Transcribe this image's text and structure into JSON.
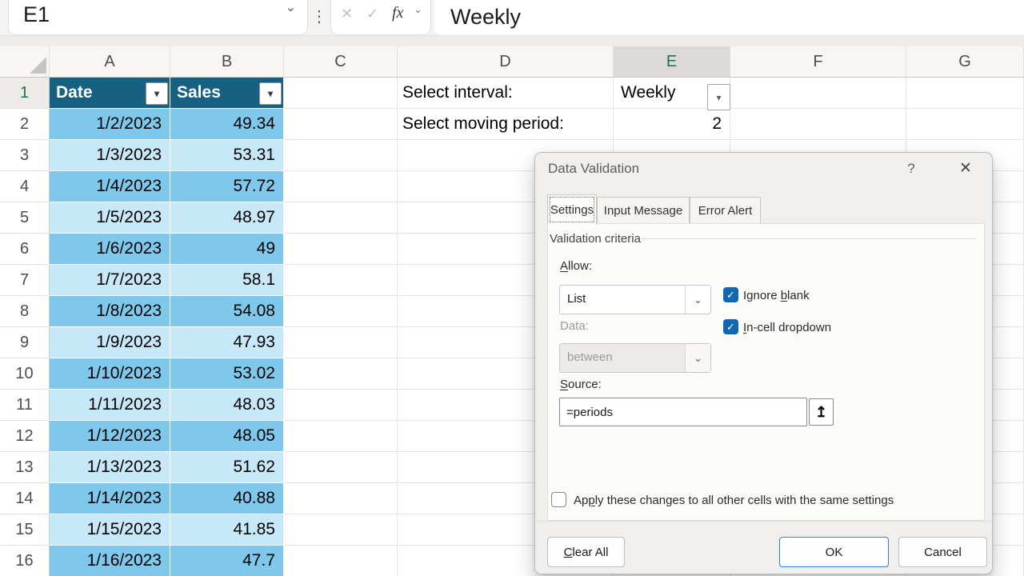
{
  "colors": {
    "excel_green": "#217346",
    "table_header_teal": "#166082",
    "band_dark": "#7EC8EB",
    "band_light": "#C7E8F8",
    "checkbox_blue": "#1267B4",
    "ok_border_blue": "#3E7FC4"
  },
  "icons": {
    "chevron_down": "⌄",
    "dropdown_arrow": "▾",
    "cancel_x": "✕",
    "check": "✓",
    "more_dots": "⋮",
    "collapse_arrow": "↥",
    "help": "?",
    "close": "✕"
  },
  "formula_bar": {
    "name_box": "E1",
    "fx_label": "fx",
    "formula": "Weekly"
  },
  "sheet": {
    "column_letters": [
      "A",
      "B",
      "C",
      "D",
      "E",
      "F",
      "G"
    ],
    "selected_column": "E",
    "row_numbers": [
      1,
      2,
      3,
      4,
      5,
      6,
      7,
      8,
      9,
      10,
      11,
      12,
      13,
      14,
      15,
      16
    ],
    "selected_row": 1,
    "table": {
      "headers": [
        "Date",
        "Sales"
      ],
      "rows": [
        [
          "1/2/2023",
          "49.34"
        ],
        [
          "1/3/2023",
          "53.31"
        ],
        [
          "1/4/2023",
          "57.72"
        ],
        [
          "1/5/2023",
          "48.97"
        ],
        [
          "1/6/2023",
          "49"
        ],
        [
          "1/7/2023",
          "58.1"
        ],
        [
          "1/8/2023",
          "54.08"
        ],
        [
          "1/9/2023",
          "47.93"
        ],
        [
          "1/10/2023",
          "53.02"
        ],
        [
          "1/11/2023",
          "48.03"
        ],
        [
          "1/12/2023",
          "48.05"
        ],
        [
          "1/13/2023",
          "51.62"
        ],
        [
          "1/14/2023",
          "40.88"
        ],
        [
          "1/15/2023",
          "41.85"
        ],
        [
          "1/16/2023",
          "47.7"
        ]
      ]
    },
    "cells": {
      "D1": "Select interval:",
      "E1": "Weekly",
      "D2": "Select moving period:",
      "E2": "2"
    }
  },
  "dialog": {
    "title": "Data Validation",
    "tabs": [
      "Settings",
      "Input Message",
      "Error Alert"
    ],
    "active_tab": "Settings",
    "section": "Validation criteria",
    "allow": {
      "text": "Allow:",
      "u": 0
    },
    "allow_value": "List",
    "ignore_blank": {
      "text": "Ignore blank",
      "u": 7
    },
    "ignore_blank_checked": true,
    "in_cell_dropdown": {
      "text": "In-cell dropdown",
      "u": 0
    },
    "in_cell_dropdown_checked": true,
    "data_label": "Data:",
    "data_value": "between",
    "source": {
      "text": "Source:",
      "u": 0
    },
    "source_value": "=periods",
    "apply": {
      "text": "Apply these changes to all other cells with the same settings",
      "u": 2
    },
    "apply_checked": false,
    "buttons": {
      "clear": {
        "text": "Clear All",
        "u": 0
      },
      "ok": "OK",
      "cancel": "Cancel"
    }
  }
}
